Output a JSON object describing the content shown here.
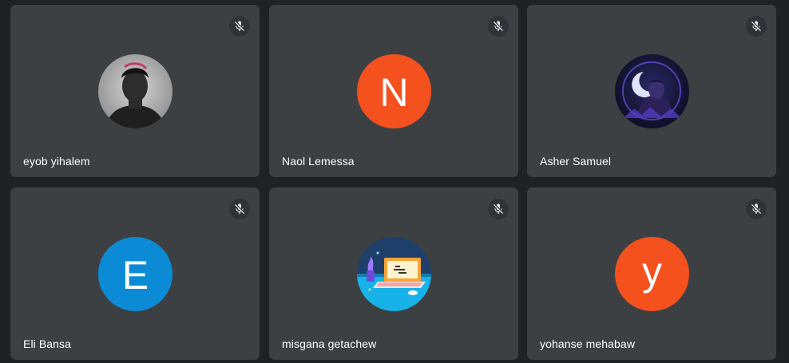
{
  "participants": [
    {
      "name": "eyob yihalem",
      "avatar_type": "photo",
      "muted": true
    },
    {
      "name": "Naol Lemessa",
      "avatar_type": "initial",
      "initial": "N",
      "avatar_color": "#f4511e",
      "muted": true
    },
    {
      "name": "Asher Samuel",
      "avatar_type": "photo",
      "muted": true
    },
    {
      "name": "Eli Bansa",
      "avatar_type": "initial",
      "initial": "E",
      "avatar_color": "#0b8bd6",
      "muted": true
    },
    {
      "name": "misgana getachew",
      "avatar_type": "illustration",
      "muted": true
    },
    {
      "name": "yohanse mehabaw",
      "avatar_type": "initial",
      "initial": "y",
      "avatar_color": "#f4511e",
      "muted": true
    }
  ],
  "icons": {
    "mute": "mic-off-icon"
  },
  "colors": {
    "background": "#202124",
    "tile": "#3c4043",
    "name_text": "#ffffff"
  }
}
